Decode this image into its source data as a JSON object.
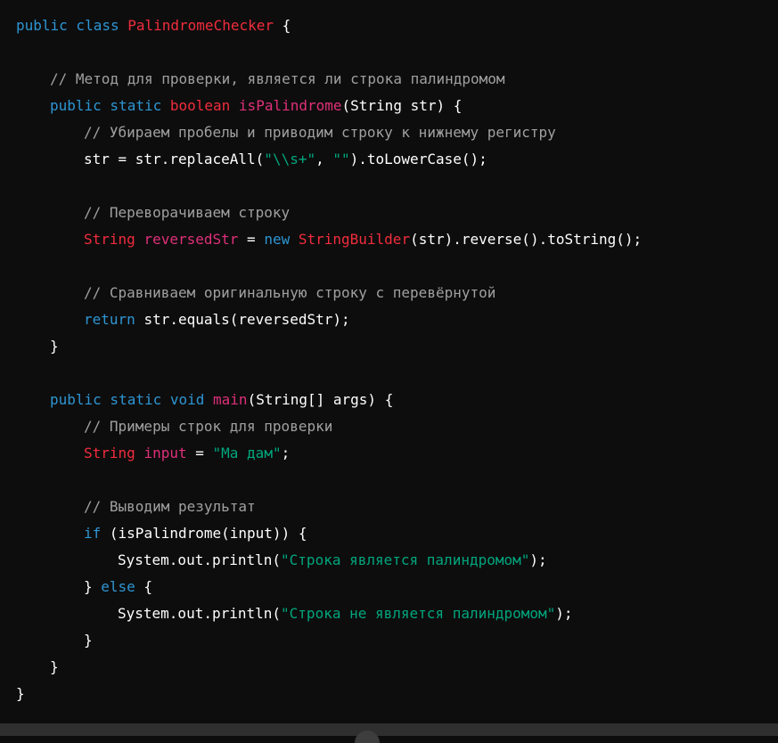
{
  "colors": {
    "background": "#0d0d0d",
    "keyword": "#2e95d3",
    "type": "#f22c3d",
    "function": "#df3079",
    "string": "#00a67d",
    "comment": "#a0a0a0",
    "plain": "#ffffff"
  },
  "code": {
    "language": "java",
    "lines": [
      {
        "indent": 0,
        "tokens": [
          {
            "t": "public class ",
            "c": "kw"
          },
          {
            "t": "PalindromeChecker",
            "c": "typ"
          },
          {
            "t": " {",
            "c": "pl"
          }
        ]
      },
      {
        "indent": 0,
        "tokens": []
      },
      {
        "indent": 1,
        "tokens": [
          {
            "t": "// Метод для проверки, является ли строка палиндромом",
            "c": "cm"
          }
        ]
      },
      {
        "indent": 1,
        "tokens": [
          {
            "t": "public static ",
            "c": "kw"
          },
          {
            "t": "boolean ",
            "c": "typ"
          },
          {
            "t": "isPalindrome",
            "c": "fn"
          },
          {
            "t": "(String str) {",
            "c": "pl"
          }
        ]
      },
      {
        "indent": 2,
        "tokens": [
          {
            "t": "// Убираем пробелы и приводим строку к нижнему регистру",
            "c": "cm"
          }
        ]
      },
      {
        "indent": 2,
        "tokens": [
          {
            "t": "str = str.replaceAll(",
            "c": "pl"
          },
          {
            "t": "\"\\\\s+\"",
            "c": "str"
          },
          {
            "t": ", ",
            "c": "pl"
          },
          {
            "t": "\"\"",
            "c": "str"
          },
          {
            "t": ").toLowerCase();",
            "c": "pl"
          }
        ]
      },
      {
        "indent": 0,
        "tokens": []
      },
      {
        "indent": 2,
        "tokens": [
          {
            "t": "// Переворачиваем строку",
            "c": "cm"
          }
        ]
      },
      {
        "indent": 2,
        "tokens": [
          {
            "t": "String ",
            "c": "typ"
          },
          {
            "t": "reversedStr",
            "c": "fn"
          },
          {
            "t": " = ",
            "c": "pl"
          },
          {
            "t": "new ",
            "c": "kw"
          },
          {
            "t": "StringBuilder",
            "c": "typ"
          },
          {
            "t": "(str).reverse().toString();",
            "c": "pl"
          }
        ]
      },
      {
        "indent": 0,
        "tokens": []
      },
      {
        "indent": 2,
        "tokens": [
          {
            "t": "// Сравниваем оригинальную строку с перевёрнутой",
            "c": "cm"
          }
        ]
      },
      {
        "indent": 2,
        "tokens": [
          {
            "t": "return ",
            "c": "kw"
          },
          {
            "t": "str.equals(reversedStr);",
            "c": "pl"
          }
        ]
      },
      {
        "indent": 1,
        "tokens": [
          {
            "t": "}",
            "c": "pl"
          }
        ]
      },
      {
        "indent": 0,
        "tokens": []
      },
      {
        "indent": 1,
        "tokens": [
          {
            "t": "public static void ",
            "c": "kw"
          },
          {
            "t": "main",
            "c": "fn"
          },
          {
            "t": "(String[] args) {",
            "c": "pl"
          }
        ]
      },
      {
        "indent": 2,
        "tokens": [
          {
            "t": "// Примеры строк для проверки",
            "c": "cm"
          }
        ]
      },
      {
        "indent": 2,
        "tokens": [
          {
            "t": "String ",
            "c": "typ"
          },
          {
            "t": "input",
            "c": "fn"
          },
          {
            "t": " = ",
            "c": "pl"
          },
          {
            "t": "\"Ма дам\"",
            "c": "str"
          },
          {
            "t": ";",
            "c": "pl"
          }
        ]
      },
      {
        "indent": 0,
        "tokens": []
      },
      {
        "indent": 2,
        "tokens": [
          {
            "t": "// Выводим результат",
            "c": "cm"
          }
        ]
      },
      {
        "indent": 2,
        "tokens": [
          {
            "t": "if ",
            "c": "kw"
          },
          {
            "t": "(isPalindrome(input)) {",
            "c": "pl"
          }
        ]
      },
      {
        "indent": 3,
        "tokens": [
          {
            "t": "System.out.println(",
            "c": "pl"
          },
          {
            "t": "\"Строка является палиндромом\"",
            "c": "str"
          },
          {
            "t": ");",
            "c": "pl"
          }
        ]
      },
      {
        "indent": 2,
        "tokens": [
          {
            "t": "} ",
            "c": "pl"
          },
          {
            "t": "else",
            "c": "kw"
          },
          {
            "t": " {",
            "c": "pl"
          }
        ]
      },
      {
        "indent": 3,
        "tokens": [
          {
            "t": "System.out.println(",
            "c": "pl"
          },
          {
            "t": "\"Строка не является палиндромом\"",
            "c": "str"
          },
          {
            "t": ");",
            "c": "pl"
          }
        ]
      },
      {
        "indent": 2,
        "tokens": [
          {
            "t": "}",
            "c": "pl"
          }
        ]
      },
      {
        "indent": 1,
        "tokens": [
          {
            "t": "}",
            "c": "pl"
          }
        ]
      },
      {
        "indent": 0,
        "tokens": [
          {
            "t": "}",
            "c": "pl"
          }
        ]
      }
    ]
  }
}
